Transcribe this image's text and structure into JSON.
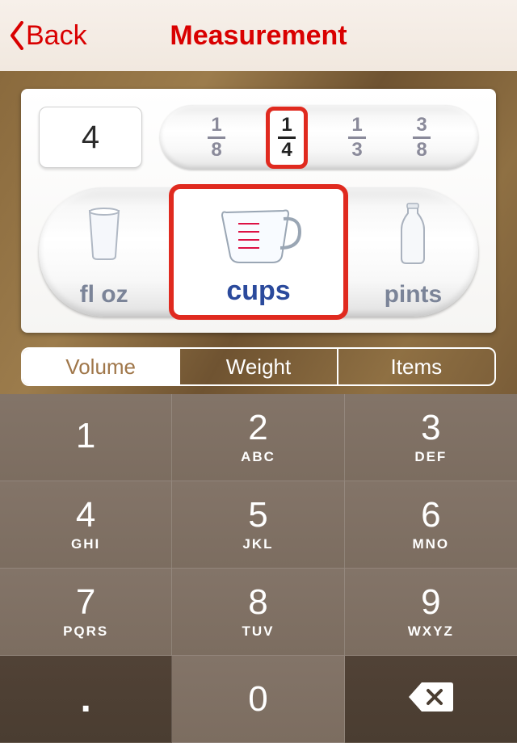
{
  "header": {
    "back_label": "Back",
    "title": "Measurement"
  },
  "amount": "4",
  "fractions": {
    "options": [
      "1/8",
      "1/4",
      "1/3",
      "3/8"
    ],
    "selected_index": 1
  },
  "units": {
    "options": [
      "fl oz",
      "cups",
      "pints"
    ],
    "selected_index": 1
  },
  "tabs": {
    "options": [
      "Volume",
      "Weight",
      "Items"
    ],
    "active_index": 0
  },
  "keypad": {
    "keys": [
      {
        "digit": "1",
        "sub": ""
      },
      {
        "digit": "2",
        "sub": "ABC"
      },
      {
        "digit": "3",
        "sub": "DEF"
      },
      {
        "digit": "4",
        "sub": "GHI"
      },
      {
        "digit": "5",
        "sub": "JKL"
      },
      {
        "digit": "6",
        "sub": "MNO"
      },
      {
        "digit": "7",
        "sub": "PQRS"
      },
      {
        "digit": "8",
        "sub": "TUV"
      },
      {
        "digit": "9",
        "sub": "WXYZ"
      }
    ],
    "decimal": ".",
    "zero": "0"
  }
}
